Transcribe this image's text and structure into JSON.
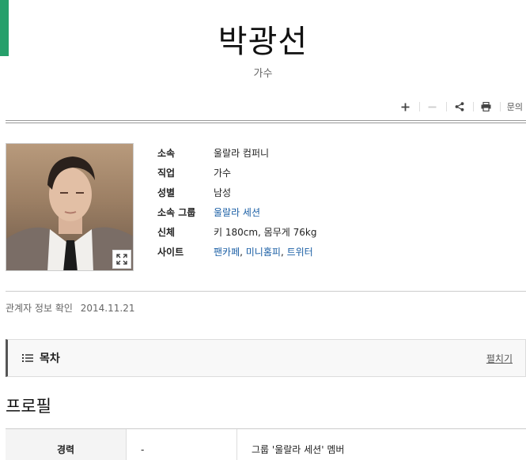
{
  "page": {
    "title": "박광선",
    "subtitle": "가수",
    "accent_color": "#26a06b",
    "link_color": "#1b5fa5"
  },
  "toolbar": {
    "buttons": [
      {
        "icon": "plus-icon"
      },
      {
        "icon": "minus-icon",
        "disabled": true
      },
      {
        "icon": "share-icon"
      },
      {
        "icon": "print-icon"
      }
    ],
    "inquiry_label": "문의"
  },
  "profile": {
    "photo_icon": "expand-icon",
    "rows": [
      {
        "label": "소속",
        "value": "울랄라 컴퍼니"
      },
      {
        "label": "직업",
        "value": "가수"
      },
      {
        "label": "성별",
        "value": "남성"
      },
      {
        "label": "소속 그룹",
        "value": "울랄라 세션"
      },
      {
        "label": "신체",
        "value": "키 180cm, 몸무게 76kg"
      },
      {
        "label": "사이트",
        "links": [
          "팬카페",
          "미니홈피",
          "트위터"
        ]
      }
    ]
  },
  "confirm": {
    "label": "관계자 정보 확인",
    "date": "2014.11.21"
  },
  "toc": {
    "title": "목차",
    "toggle_label": "펼치기"
  },
  "section": {
    "title": "프로필"
  },
  "table": {
    "row": {
      "head": "경력",
      "period": "-",
      "detail": "그룹 '울랄라 세션' 멤버"
    }
  }
}
